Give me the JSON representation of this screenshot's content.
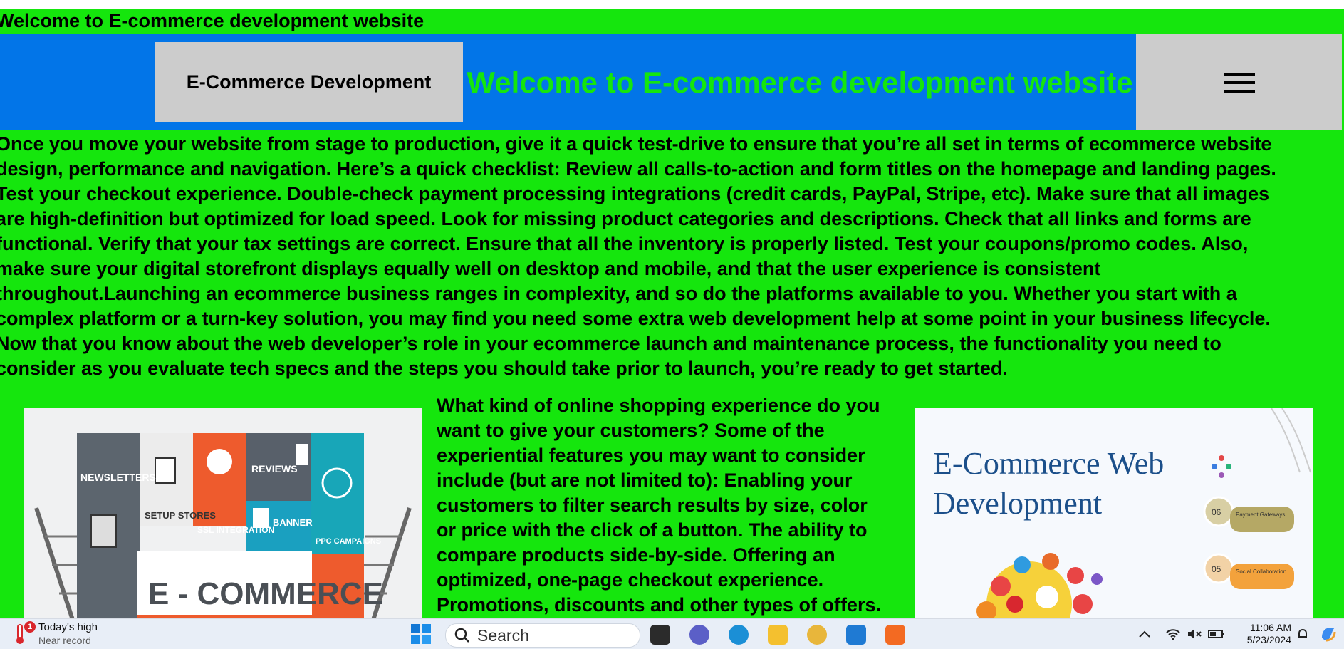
{
  "page": {
    "top_line": "Welcome to E-commerce development website",
    "header": {
      "brand": "E-Commerce Development",
      "title": "Welcome to E-commerce development website",
      "menu_icon": "hamburger-icon"
    },
    "intro_lines": [
      "Once you move your website from stage to production, give it a quick test-drive to ensure that you’re all set in terms of ecommerce website",
      "design, performance and navigation. Here’s a quick checklist: Review all calls-to-action and form titles on the homepage and landing pages.",
      "Test your checkout experience. Double-check payment processing integrations (credit cards, PayPal, Stripe, etc). Make sure that all images",
      "are high-definition but optimized for load speed. Look for missing product categories and descriptions. Check that all links and forms are",
      "functional. Verify that your tax settings are correct. Ensure that all the inventory is properly listed. Test your coupons/promo codes. Also,",
      "make sure your digital storefront displays equally well on desktop and mobile, and that the user experience is consistent",
      "throughout.Launching an ecommerce business ranges in complexity, and so do the platforms available to you. Whether you start with a",
      "complex platform or a turn-key solution, you may find you need some extra web development help at some point in your business lifecycle.",
      "Now that you know about the web developer’s role in your ecommerce launch and maintenance process, the functionality you need to",
      "consider as you evaluate tech specs and the steps you should take prior to launch, you’re ready to get started."
    ],
    "mid_lines": [
      "What kind of online shopping experience do you",
      "want to give your customers? Some of the",
      "experiential features you may want to consider",
      "include (but are not limited to): Enabling your",
      "customers to filter search results by size, color",
      "or price with the click of a button. The ability to",
      "compare products side-by-side. Offering an",
      "optimized, one-page checkout experience.",
      "Promotions, discounts and other types of offers."
    ],
    "left_image": {
      "labels": [
        "NEWSLETTERS",
        "SETUP STORES",
        "SSL INTEGRATION",
        "REVIEWS",
        "BANNER",
        "PPC CAMPAIGNS",
        "E - COMMERCE"
      ]
    },
    "right_image": {
      "title_line1": "E-Commerce  Web",
      "title_line2": "Development",
      "steps": [
        "06",
        "05"
      ],
      "step_labels": [
        "Payment Gateways",
        "Social Collaboration"
      ]
    }
  },
  "taskbar": {
    "weather_title": "Today's high",
    "weather_sub": "Near record",
    "weather_badge": "1",
    "search_label": "Search",
    "time": "11:06 AM",
    "date": "5/23/2024",
    "colors": {
      "bg": "#e8eef7",
      "page_green": "#15e60d",
      "header_blue": "#0275e8"
    }
  }
}
